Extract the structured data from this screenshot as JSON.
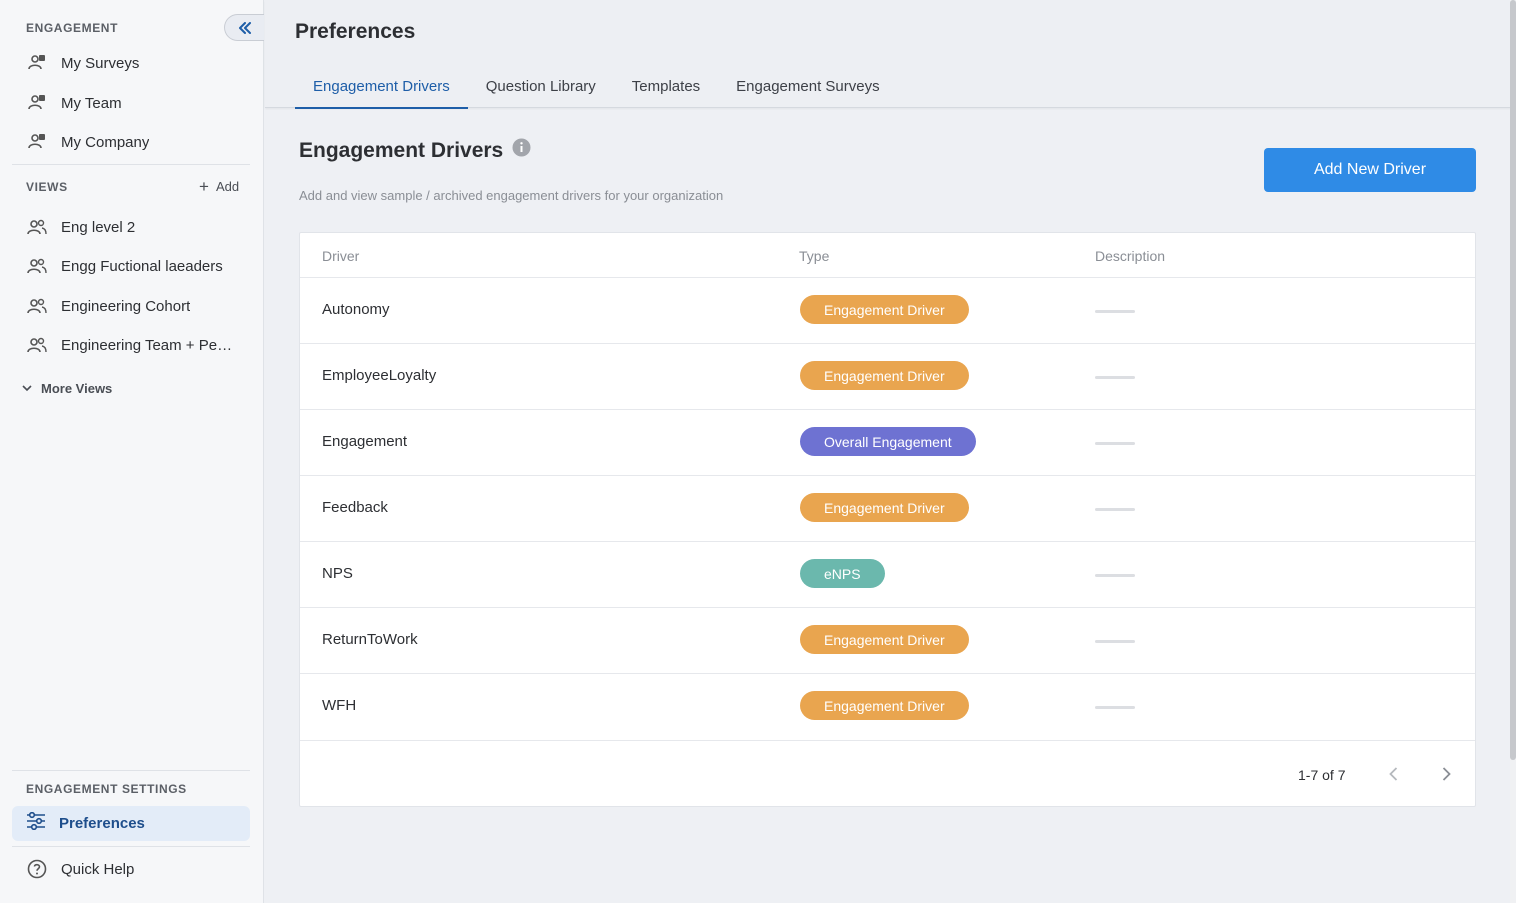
{
  "sidebar": {
    "engagement_label": "ENGAGEMENT",
    "engagement_items": [
      {
        "label": "My Surveys",
        "icon": "survey-icon"
      },
      {
        "label": "My Team",
        "icon": "team-survey-icon"
      },
      {
        "label": "My Company",
        "icon": "company-survey-icon"
      }
    ],
    "views_label": "VIEWS",
    "add_label": "Add",
    "views": [
      {
        "label": "Eng level 2",
        "icon": "group-icon"
      },
      {
        "label": "Engg Fuctional laeaders",
        "icon": "group-icon"
      },
      {
        "label": "Engineering Cohort",
        "icon": "group-icon"
      },
      {
        "label": "Engineering Team + Peo…",
        "icon": "group-icon"
      }
    ],
    "more_views_label": "More Views",
    "settings_label": "ENGAGEMENT SETTINGS",
    "preferences_label": "Preferences",
    "quick_help_label": "Quick Help"
  },
  "header": {
    "title": "Preferences",
    "tabs": [
      {
        "label": "Engagement Drivers",
        "active": true
      },
      {
        "label": "Question Library",
        "active": false
      },
      {
        "label": "Templates",
        "active": false
      },
      {
        "label": "Engagement Surveys",
        "active": false
      }
    ]
  },
  "content": {
    "title": "Engagement Drivers",
    "subtitle": "Add and view sample / archived engagement drivers for your organization",
    "add_button": "Add New Driver"
  },
  "table": {
    "columns": [
      "Driver",
      "Type",
      "Description"
    ],
    "rows": [
      {
        "driver": "Autonomy",
        "type": "Engagement Driver",
        "color": "#e9a54f"
      },
      {
        "driver": "EmployeeLoyalty",
        "type": "Engagement Driver",
        "color": "#e9a54f"
      },
      {
        "driver": "Engagement",
        "type": "Overall Engagement",
        "color": "#6e72d2"
      },
      {
        "driver": "Feedback",
        "type": "Engagement Driver",
        "color": "#e9a54f"
      },
      {
        "driver": "NPS",
        "type": "eNPS",
        "color": "#6bb8ad"
      },
      {
        "driver": "ReturnToWork",
        "type": "Engagement Driver",
        "color": "#e9a54f"
      },
      {
        "driver": "WFH",
        "type": "Engagement Driver",
        "color": "#e9a54f"
      }
    ],
    "pagination": "1-7 of 7"
  },
  "colors": {
    "accent": "#1e5ea8",
    "primary_button": "#2f8be6",
    "engagement_driver": "#e9a54f",
    "overall_engagement": "#6e72d2",
    "enps": "#6bb8ad"
  }
}
